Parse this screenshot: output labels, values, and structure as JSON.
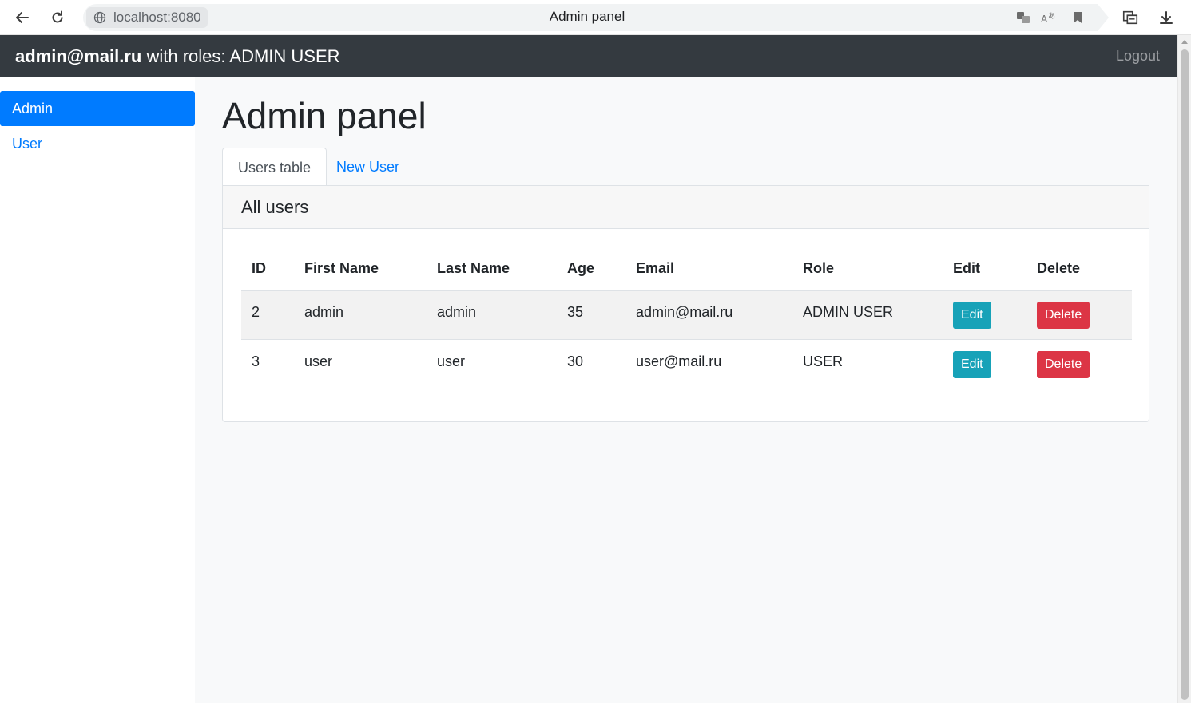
{
  "browser": {
    "url": "localhost:8080",
    "tab_title": "Admin panel"
  },
  "navbar": {
    "email": "admin@mail.ru",
    "roles_text": " with roles: ADMIN USER",
    "logout_label": "Logout"
  },
  "sidebar": {
    "items": [
      {
        "label": "Admin",
        "active": true
      },
      {
        "label": "User",
        "active": false
      }
    ]
  },
  "main": {
    "title": "Admin panel",
    "tabs": [
      {
        "label": "Users table",
        "active": true
      },
      {
        "label": "New User",
        "active": false
      }
    ],
    "card_title": "All users"
  },
  "table": {
    "headers": [
      "ID",
      "First Name",
      "Last Name",
      "Age",
      "Email",
      "Role",
      "Edit",
      "Delete"
    ],
    "rows": [
      {
        "id": "2",
        "first_name": "admin",
        "last_name": "admin",
        "age": "35",
        "email": "admin@mail.ru",
        "role": "ADMIN USER",
        "edit": "Edit",
        "delete": "Delete"
      },
      {
        "id": "3",
        "first_name": "user",
        "last_name": "user",
        "age": "30",
        "email": "user@mail.ru",
        "role": "USER",
        "edit": "Edit",
        "delete": "Delete"
      }
    ]
  },
  "colors": {
    "primary": "#007bff",
    "navbar": "#343a40",
    "edit": "#17a2b8",
    "delete": "#dc3545"
  }
}
